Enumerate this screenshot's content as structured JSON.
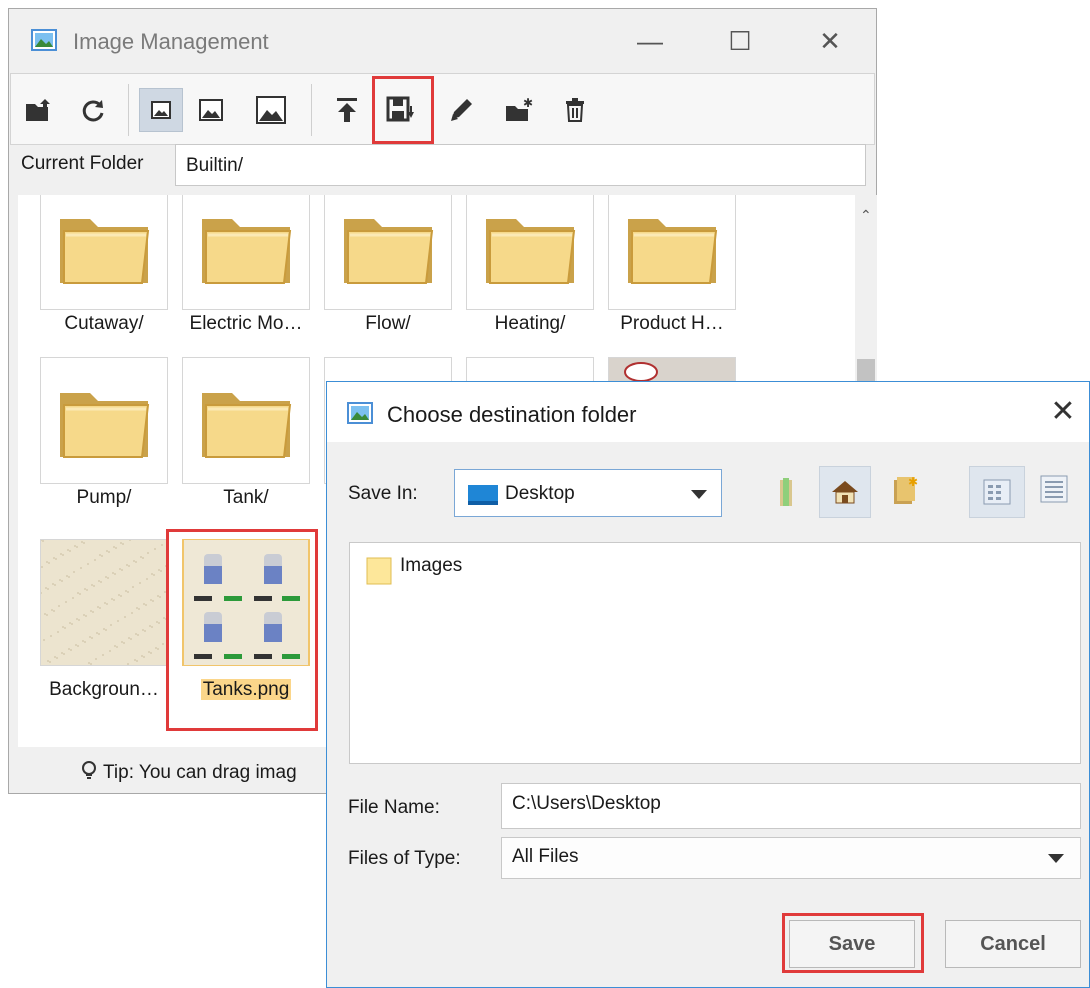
{
  "main_window": {
    "title": "Image Management",
    "controls": {
      "minimize": "—",
      "maximize": "☐",
      "close": "✕"
    },
    "toolbar_icons": [
      "open-folder-icon",
      "refresh-icon",
      "small-image-icon",
      "medium-image-icon",
      "large-image-icon",
      "upload-icon",
      "save-download-icon",
      "edit-icon",
      "new-folder-icon",
      "delete-icon"
    ],
    "current_folder_label": "Current Folder",
    "current_folder_value": "Builtin/",
    "items": [
      {
        "label": "Cutaway/",
        "kind": "folder"
      },
      {
        "label": "Electric Mo…",
        "kind": "folder"
      },
      {
        "label": "Flow/",
        "kind": "folder"
      },
      {
        "label": "Heating/",
        "kind": "folder"
      },
      {
        "label": "Product H…",
        "kind": "folder"
      },
      {
        "label": "Pump/",
        "kind": "folder"
      },
      {
        "label": "Tank/",
        "kind": "folder"
      },
      {
        "label": "",
        "kind": "blank"
      },
      {
        "label": "",
        "kind": "blank"
      },
      {
        "label": "",
        "kind": "image"
      },
      {
        "label": "Backgroun…",
        "kind": "texture"
      },
      {
        "label": "Tanks.png",
        "kind": "tanks",
        "selected": true
      }
    ],
    "tip": "Tip: You can drag imag"
  },
  "dialog": {
    "title": "Choose destination folder",
    "close": "✕",
    "save_in_label": "Save In:",
    "save_in_value": "Desktop",
    "file_list": [
      {
        "label": "Images",
        "kind": "folder"
      }
    ],
    "file_name_label": "File Name:",
    "file_name_value": "C:\\Users\\Desktop",
    "files_of_type_label": "Files of Type:",
    "files_of_type_value": "All Files",
    "save_button": "Save",
    "cancel_button": "Cancel"
  },
  "colors": {
    "highlight": "#e03a3a",
    "selection": "#fbd68a",
    "accent": "#3c8ed6"
  }
}
